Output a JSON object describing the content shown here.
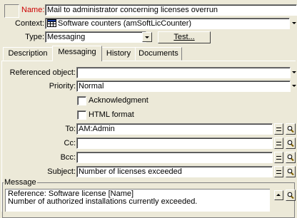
{
  "header": {
    "name_label": "Name:",
    "name_value": "Mail to administrator concerning licenses overrun",
    "context_label": "Context:",
    "context_value": "Software counters (amSoftLicCounter)",
    "context_icon": "table-icon",
    "type_label": "Type:",
    "type_value": "Messaging",
    "test_label": "Test..."
  },
  "tabs": [
    {
      "label": "Description"
    },
    {
      "label": "Messaging"
    },
    {
      "label": "History"
    },
    {
      "label": "Documents"
    }
  ],
  "messaging": {
    "referenced_object_label": "Referenced object:",
    "referenced_object_value": "",
    "priority_label": "Priority:",
    "priority_value": "Normal",
    "acknowledgment_label": "Acknowledgment",
    "acknowledgment_checked": false,
    "html_format_label": "HTML format",
    "html_format_checked": false,
    "to_label": "To:",
    "to_value": "AM:Admin",
    "cc_label": "Cc:",
    "cc_value": "",
    "bcc_label": "Bcc:",
    "bcc_value": "",
    "subject_label": "Subject:",
    "subject_value": "Number of licenses exceeded",
    "message_group_label": "Message",
    "message_lines": [
      "Reference: Software license [Name]",
      "Number of authorized installations currently exceeded."
    ]
  },
  "colors": {
    "window_bg": "#ece9d8",
    "name_label": "#cc0000"
  }
}
